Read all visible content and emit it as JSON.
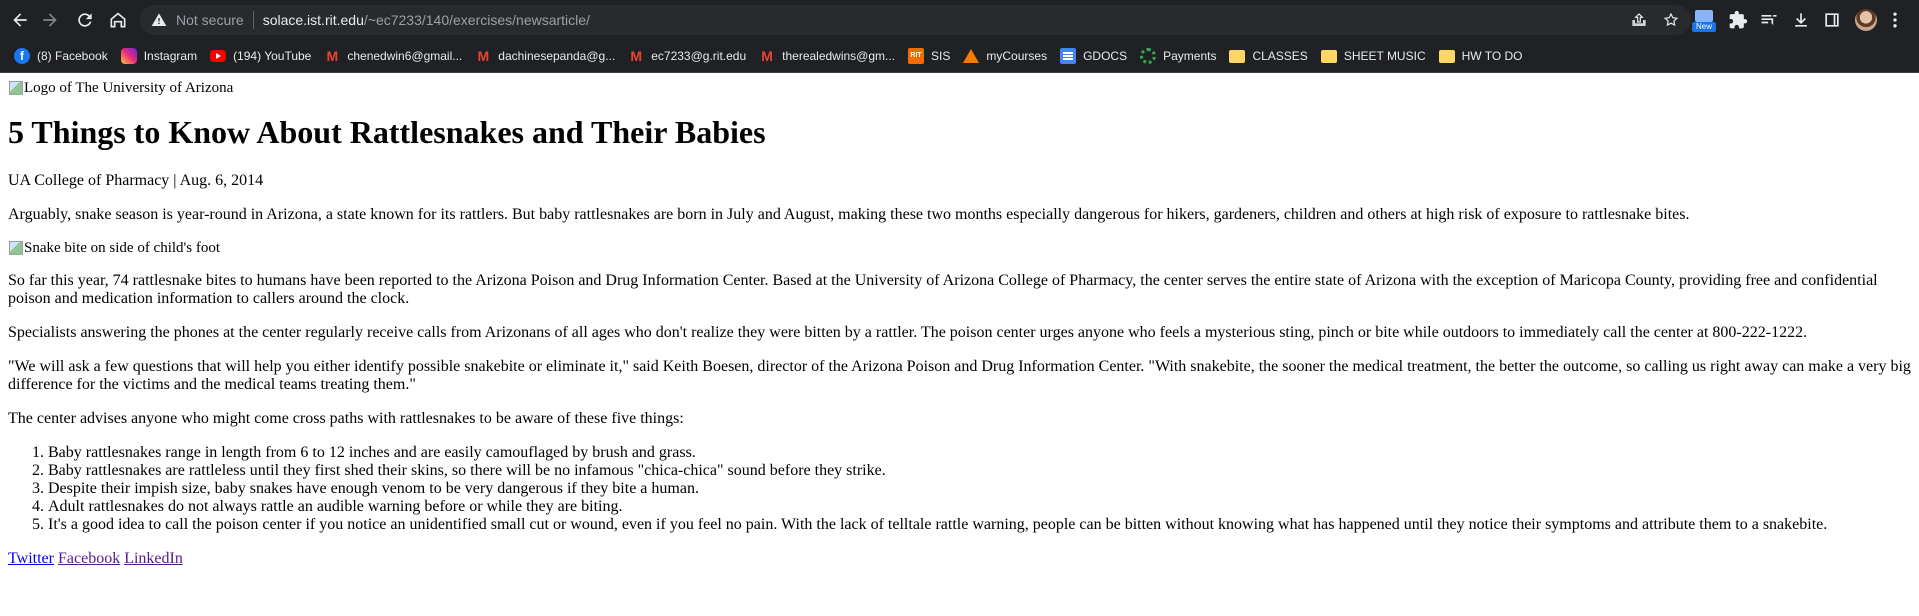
{
  "browser": {
    "security_label": "Not secure",
    "url_host": "solace.ist.rit.edu",
    "url_path": "/~ec7233/140/exercises/newsarticle/",
    "extension_badge": "New",
    "bookmarks": [
      {
        "label": "(8) Facebook",
        "icon": "facebook-icon"
      },
      {
        "label": "Instagram",
        "icon": "instagram-icon"
      },
      {
        "label": "(194) YouTube",
        "icon": "youtube-icon"
      },
      {
        "label": "chenedwin6@gmail...",
        "icon": "gmail-icon"
      },
      {
        "label": "dachinesepanda@g...",
        "icon": "gmail-icon"
      },
      {
        "label": "ec7233@g.rit.edu",
        "icon": "gmail-icon"
      },
      {
        "label": "therealedwins@gm...",
        "icon": "gmail-icon"
      },
      {
        "label": "SIS",
        "icon": "rit-icon",
        "icon_text": "RIT"
      },
      {
        "label": "myCourses",
        "icon": "mycourses-icon"
      },
      {
        "label": "GDOCS",
        "icon": "google-docs-icon"
      },
      {
        "label": "Payments",
        "icon": "payments-icon"
      },
      {
        "label": "CLASSES",
        "icon": "folder-icon"
      },
      {
        "label": "SHEET MUSIC",
        "icon": "folder-icon"
      },
      {
        "label": "HW TO DO",
        "icon": "folder-icon"
      }
    ]
  },
  "article": {
    "logo_alt": "Logo of The University of Arizona",
    "title": "5 Things to Know About Rattlesnakes and Their Babies",
    "byline": "UA College of Pharmacy | Aug. 6, 2014",
    "intro": "Arguably, snake season is year-round in Arizona, a state known for its rattlers. But baby rattlesnakes are born in July and August, making these two months especially dangerous for hikers, gardeners, children and others at high risk of exposure to rattlesnake bites.",
    "image_alt": "Snake bite on side of child's foot",
    "paragraphs": [
      "So far this year, 74 rattlesnake bites to humans have been reported to the Arizona Poison and Drug Information Center. Based at the University of Arizona College of Pharmacy, the center serves the entire state of Arizona with the exception of Maricopa County, providing free and confidential poison and medication information to callers around the clock.",
      "Specialists answering the phones at the center regularly receive calls from Arizonans of all ages who don't realize they were bitten by a rattler. The poison center urges anyone who feels a mysterious sting, pinch or bite while outdoors to immediately call the center at 800-222-1222.",
      "\"We will ask a few questions that will help you either identify possible snakebite or eliminate it,\" said Keith Boesen, director of the Arizona Poison and Drug Information Center. \"With snakebite, the sooner the medical treatment, the better the outcome, so calling us right away can make a very big difference for the victims and the medical teams treating them.\"",
      "The center advises anyone who might come cross paths with rattlesnakes to be aware of these five things:"
    ],
    "list": [
      "Baby rattlesnakes range in length from 6 to 12 inches and are easily camouflaged by brush and grass.",
      "Baby rattlesnakes are rattleless until they first shed their skins, so there will be no infamous \"chica-chica\" sound before they strike.",
      "Despite their impish size, baby snakes have enough venom to be very dangerous if they bite a human.",
      "Adult rattlesnakes do not always rattle an audible warning before or while they are biting.",
      "It's a good idea to call the poison center if you notice an unidentified small cut or wound, even if you feel no pain. With the lack of telltale rattle warning, people can be bitten without knowing what has happened until they notice their symptoms and attribute them to a snakebite."
    ],
    "share_links": [
      "Twitter",
      "Facebook",
      "LinkedIn"
    ]
  }
}
